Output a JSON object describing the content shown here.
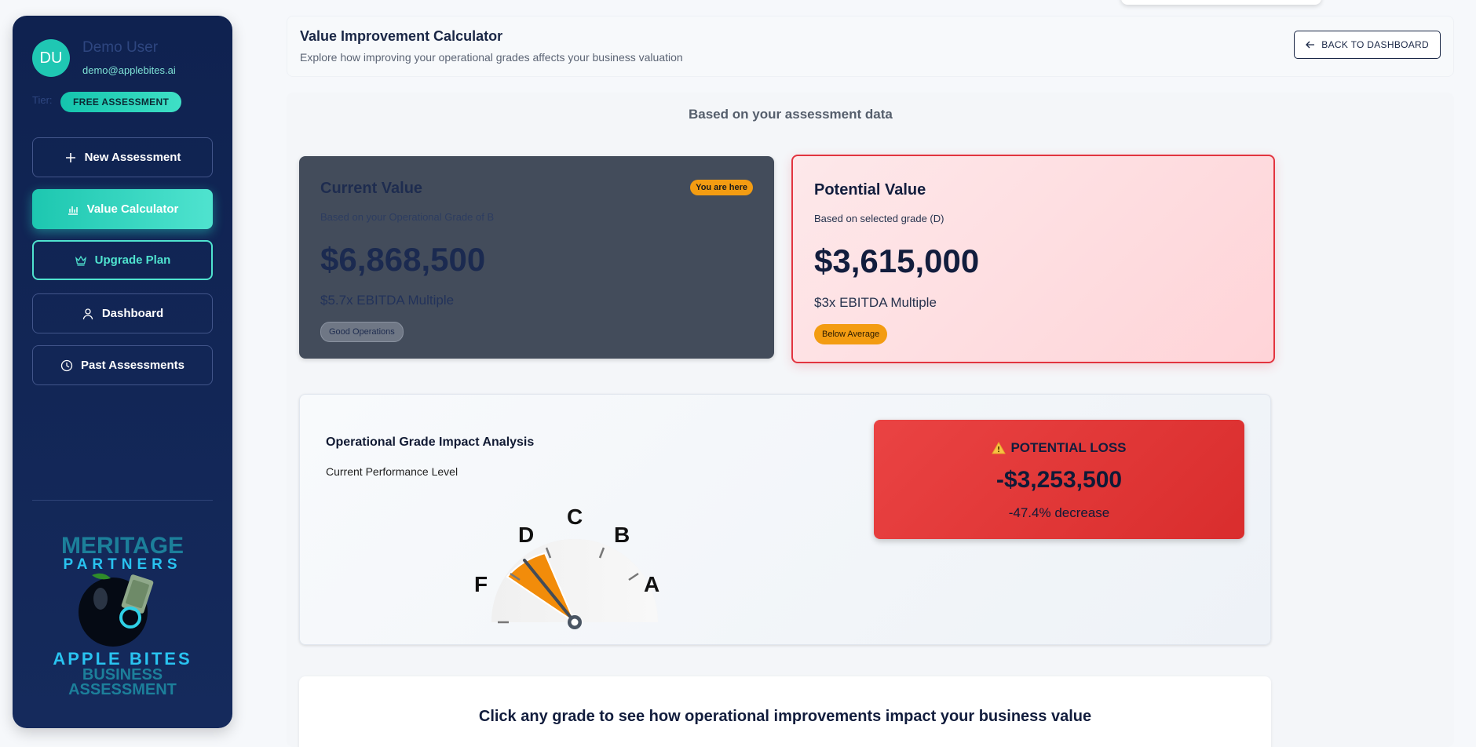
{
  "sidebar": {
    "avatar_initials": "DU",
    "user_name": "Demo User",
    "user_email": "demo@applebites.ai",
    "tier_label": "Tier:",
    "tier_badge": "FREE ASSESSMENT",
    "nav": [
      {
        "label": "New Assessment",
        "icon": "plus-icon"
      },
      {
        "label": "Value Calculator",
        "icon": "bar-chart-icon",
        "active": true
      },
      {
        "label": "Upgrade Plan",
        "icon": "crown-icon"
      },
      {
        "label": "Dashboard",
        "icon": "user-icon"
      },
      {
        "label": "Past Assessments",
        "icon": "clock-icon"
      }
    ],
    "logo": {
      "line1": "MERITAGE",
      "line2": "PARTNERS",
      "line3": "APPLE BITES",
      "line4": "BUSINESS",
      "line5": "ASSESSMENT"
    }
  },
  "header": {
    "title": "Value Improvement Calculator",
    "subtitle": "Explore how improving your operational grades affects your business valuation",
    "back_button": "BACK TO DASHBOARD"
  },
  "main": {
    "based_on": "Based on your assessment data",
    "current": {
      "title": "Current Value",
      "badge": "You are here",
      "subtitle": "Based on your Operational Grade of B",
      "value": "$6,868,500",
      "multiple": "$5.7x EBITDA Multiple",
      "status": "Good Operations"
    },
    "potential": {
      "title": "Potential Value",
      "subtitle": "Based on selected grade (D)",
      "value": "$3,615,000",
      "multiple": "$3x EBITDA Multiple",
      "status": "Below Average"
    },
    "analysis": {
      "title": "Operational Grade Impact Analysis",
      "subtitle": "Current Performance Level",
      "gauge_labels": [
        "F",
        "D",
        "C",
        "B",
        "A"
      ],
      "selected_grade": "D"
    },
    "loss": {
      "title": "POTENTIAL LOSS",
      "amount": "-$3,253,500",
      "percent": "-47.4% decrease"
    },
    "bottom_prompt": "Click any grade to see how operational improvements impact your business value"
  },
  "colors": {
    "accent": "#1dc7b0",
    "sidebar_bg": "#0f2250",
    "loss_red": "#e23a3a",
    "badge_orange": "#f39c12"
  }
}
